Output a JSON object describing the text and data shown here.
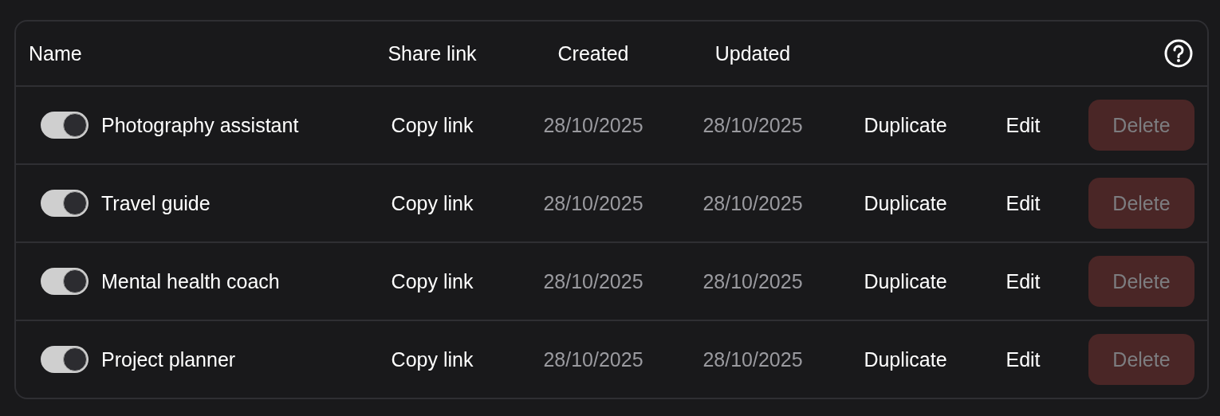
{
  "table": {
    "columns": [
      "Name",
      "Share link",
      "Created",
      "Updated"
    ],
    "rows": [
      {
        "enabled": true,
        "name": "Photography assistant",
        "share": "Copy link",
        "created": "28/10/2025",
        "updated": "28/10/2025",
        "duplicate": "Duplicate",
        "edit": "Edit",
        "delete": {
          "label": "Delete",
          "disabled": true
        }
      },
      {
        "enabled": true,
        "name": "Travel guide",
        "share": "Copy link",
        "created": "28/10/2025",
        "updated": "28/10/2025",
        "duplicate": "Duplicate",
        "edit": "Edit",
        "delete": {
          "label": "Delete",
          "disabled": true
        }
      },
      {
        "enabled": true,
        "name": "Mental health coach",
        "share": "Copy link",
        "created": "28/10/2025",
        "updated": "28/10/2025",
        "duplicate": "Duplicate",
        "edit": "Edit",
        "delete": {
          "label": "Delete",
          "disabled": true
        }
      },
      {
        "enabled": true,
        "name": "Project planner",
        "share": "Copy link",
        "created": "28/10/2025",
        "updated": "28/10/2025",
        "duplicate": "Duplicate",
        "edit": "Edit",
        "delete": {
          "label": "Delete",
          "disabled": true
        }
      }
    ]
  }
}
